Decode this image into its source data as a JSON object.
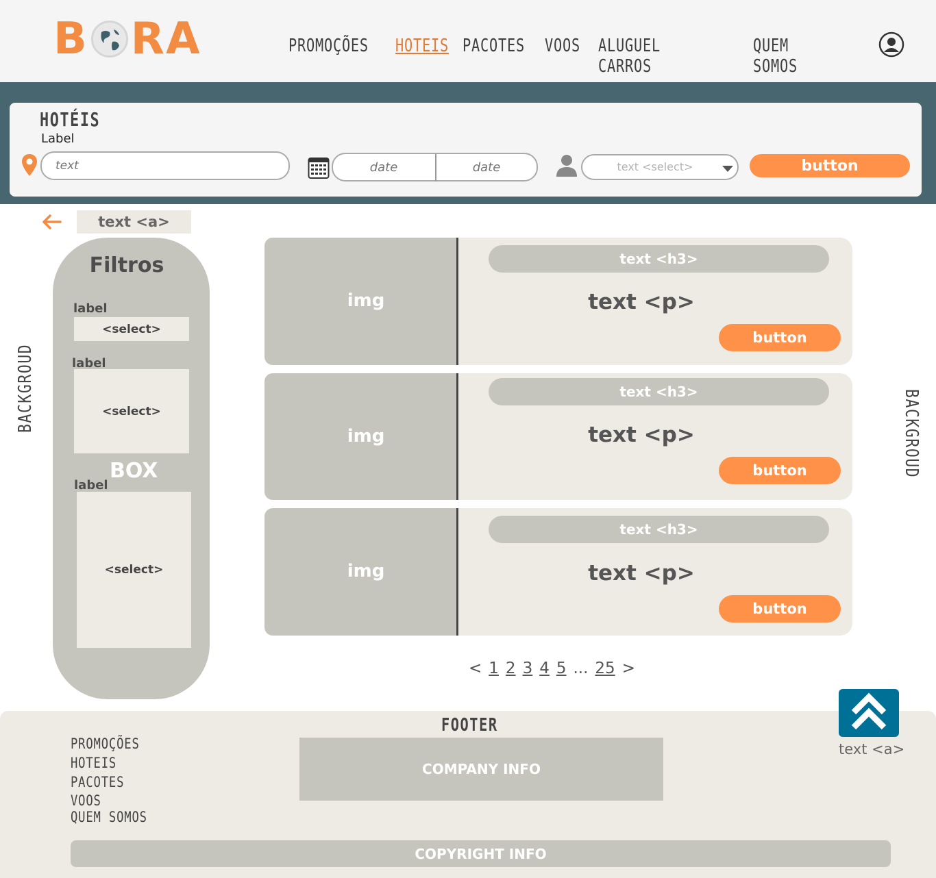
{
  "header": {
    "logo_text_left": "B",
    "logo_text_right": "RA",
    "nav": [
      {
        "label": "PROMOÇÕES",
        "active": false
      },
      {
        "label": "HOTEIS",
        "active": true
      },
      {
        "label": "PACOTES",
        "active": false
      },
      {
        "label": "VOOS",
        "active": false
      },
      {
        "label": "ALUGUEL CARROS",
        "active": false
      },
      {
        "label": "QUEM SOMOS",
        "active": false
      }
    ],
    "user_icon": "user-circle-icon"
  },
  "search": {
    "title": "HOTÉIS",
    "label": "Label",
    "location_placeholder": "text",
    "date_from_placeholder": "date",
    "date_to_placeholder": "date",
    "guests_select": "text <select>",
    "button": "button"
  },
  "back": {
    "link": "text <a>"
  },
  "side_labels": {
    "left": "BACKGROUD",
    "right": "BACKGROUD"
  },
  "filters": {
    "title": "Filtros",
    "box_label": "BOX",
    "items": [
      {
        "label": "label",
        "select": "<select>"
      },
      {
        "label": "label",
        "select": "<select>"
      },
      {
        "label": "label",
        "select": "<select>"
      }
    ]
  },
  "results": [
    {
      "img": "img",
      "title": "text <h3>",
      "text": "text <p>",
      "button": "button"
    },
    {
      "img": "img",
      "title": "text <h3>",
      "text": "text <p>",
      "button": "button"
    },
    {
      "img": "img",
      "title": "text <h3>",
      "text": "text <p>",
      "button": "button"
    }
  ],
  "pagination": {
    "prev": "<",
    "pages": [
      "1",
      "2",
      "3",
      "4",
      "5"
    ],
    "ellipsis": "...",
    "last": "25",
    "next": ">"
  },
  "footer": {
    "title": "FOOTER",
    "links": [
      "PROMOÇÕES",
      "HOTEIS",
      "PACOTES",
      "VOOS",
      "QUEM SOMOS"
    ],
    "company_info": "COMPANY INFO",
    "copyright": "COPYRIGHT INFO",
    "back_to_top_link": "text <a>"
  },
  "colors": {
    "accent_orange": "#ff9148",
    "band": "#486670",
    "card_bg": "#eeeae4",
    "gray_block": "#c6c5bd",
    "top_button": "#007196"
  }
}
